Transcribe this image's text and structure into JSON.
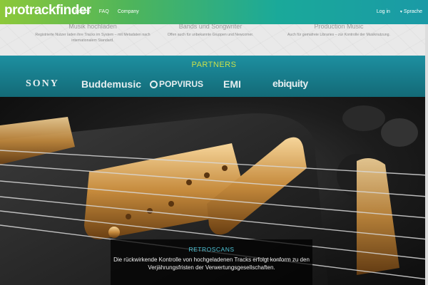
{
  "header": {
    "logo": "protrackfinder",
    "nav": [
      "Kosten",
      "FAQ",
      "Company"
    ],
    "login": "Log in",
    "language": "Sprache"
  },
  "features": [
    {
      "title": "Musik hochladen",
      "text": "Registrierte Nutzer laden ihre Tracks im System – mit Metadaten nach internationalem Standard."
    },
    {
      "title": "Bands und Songwriter",
      "text": "Offen auch für unbekannte Gruppen und Newcomer."
    },
    {
      "title": "Production Music",
      "text": "Auch für gemafreie Libraries – zur Kontrolle der Musiknutzung."
    }
  ],
  "partners": {
    "title": "PARTNERS",
    "logos": [
      "SONY",
      "Buddemusic",
      "POPVIRUS",
      "EMI",
      "ebiquity"
    ]
  },
  "caption": {
    "title": "RETROSCANS",
    "text": "Die rückwirkende Kontrolle von hochgeladenen Tracks erfolgt konform zu den Verjährungsfristen der Verwertungsgesellschaften."
  },
  "colors": {
    "header_gradient_start": "#8dc83a",
    "header_gradient_end": "#1a9aa6",
    "partners_band": "#1d8fa0",
    "partners_title": "#c9e04a",
    "caption_title": "#4ec3d6"
  }
}
